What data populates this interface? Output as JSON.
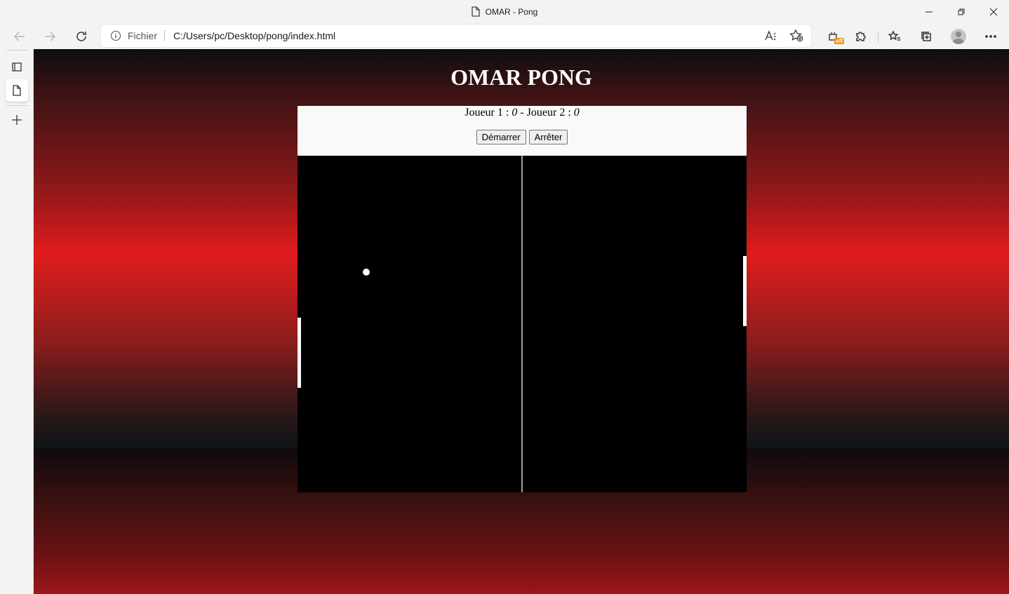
{
  "browser": {
    "tab_title": "OMAR - Pong",
    "address": {
      "label": "Fichier",
      "url": "C:/Users/pc/Desktop/pong/index.html"
    },
    "extension_badge": "off"
  },
  "page": {
    "title": "OMAR PONG",
    "score": {
      "player1_label": "Joueur 1 : ",
      "player1_score": "0",
      "separator": " - ",
      "player2_label": "Joueur 2 : ",
      "player2_score": "0"
    },
    "buttons": {
      "start": "Démarrer",
      "stop": "Arrêter"
    }
  },
  "colors": {
    "court": "#000000",
    "net": "#9a9a9a",
    "paddle": "#ffffff",
    "ball": "#ffffff",
    "background_accent": "#e01c1c"
  }
}
